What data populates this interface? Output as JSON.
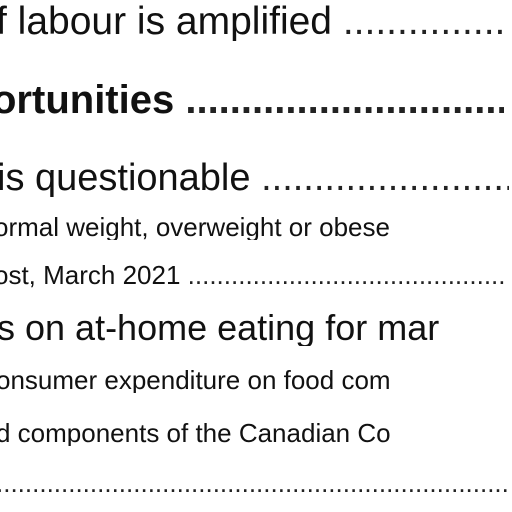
{
  "toc": {
    "entries": [
      {
        "text": "f labour is amplified ",
        "leader": "................................"
      },
      {
        "text": "ortunities ",
        "leader": "................................"
      },
      {
        "text": "is questionable ",
        "leader": "................................"
      },
      {
        "text": "ormal weight, overweight or obese",
        "leader": ""
      },
      {
        "text": "ost, March 2021 ",
        "leader": "........................................................................"
      },
      {
        "text": "s on at-home eating for mar",
        "leader": ""
      },
      {
        "text": "onsumer expenditure on food com",
        "leader": ""
      },
      {
        "text": "d components of the Canadian Co",
        "leader": ""
      },
      {
        "text": "",
        "leader": "........................................................................................................................"
      }
    ]
  }
}
